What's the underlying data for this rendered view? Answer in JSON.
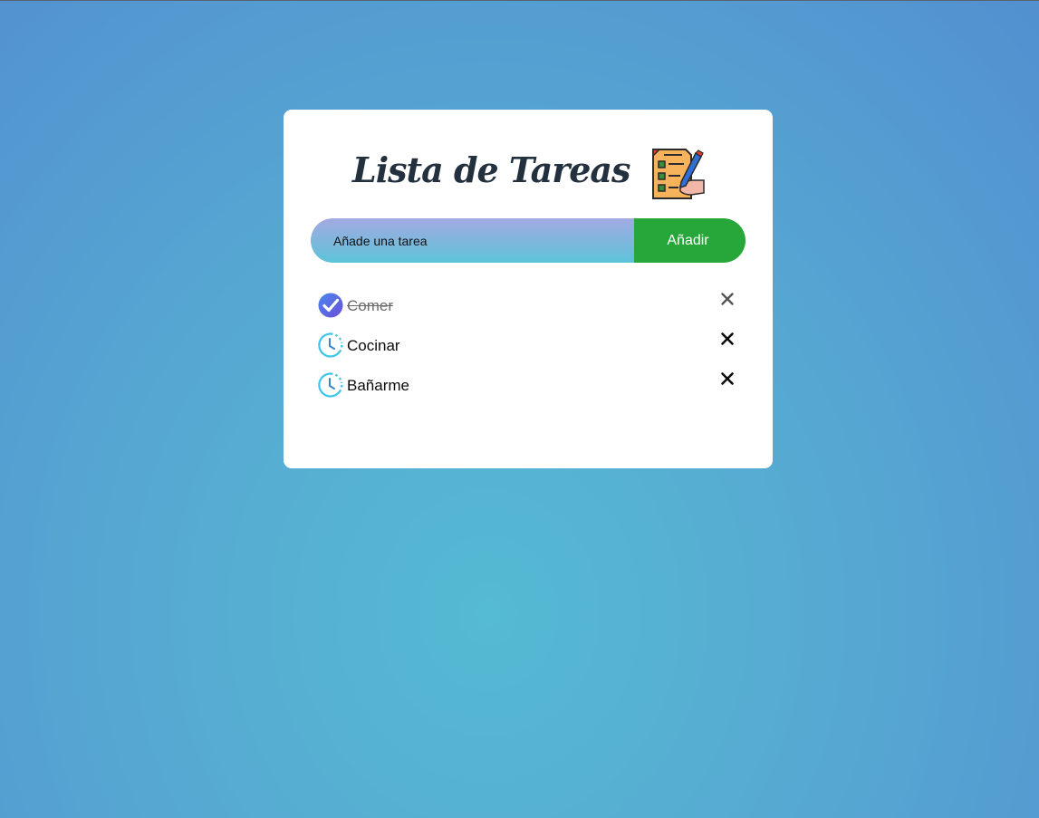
{
  "app": {
    "title": "Lista de Tareas",
    "logo_icon": "checklist-clipboard-pencil-icon"
  },
  "input": {
    "placeholder": "Añade una tarea",
    "value": ""
  },
  "add_button": {
    "label": "Añadir"
  },
  "tasks": [
    {
      "text": "Comer",
      "completed": true,
      "status_icon": "checked-circle-icon"
    },
    {
      "text": "Cocinar",
      "completed": false,
      "status_icon": "pending-clock-icon"
    },
    {
      "text": "Bañarme",
      "completed": false,
      "status_icon": "pending-clock-icon"
    }
  ],
  "delete_icon": "close-icon",
  "colors": {
    "accent_green": "#27a63a",
    "check_blue": "#3e6ee8",
    "clock_cyan": "#3ec6e8",
    "title_text": "#23303e"
  }
}
